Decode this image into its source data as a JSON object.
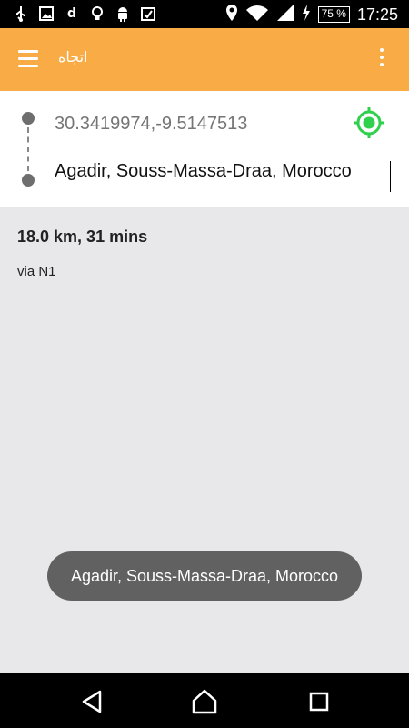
{
  "status_bar": {
    "left_icons": [
      "usb-icon",
      "image-icon",
      "d-icon",
      "lightbulb-icon",
      "android-icon",
      "clipboard-check-icon"
    ],
    "d_icon_text": "d",
    "right_icons": [
      "location-icon",
      "wifi-icon",
      "signal-icon",
      "charging-icon"
    ],
    "battery": "75 %",
    "time": "17:25"
  },
  "app_bar": {
    "title": "اتجاه",
    "color": "#f9ab46"
  },
  "route_inputs": {
    "from_placeholder": "30.3419974,-9.5147513",
    "to_value": "Agadir, Souss-Massa-Draa, Morocco"
  },
  "route": {
    "summary": "18.0 km, 31 mins",
    "via": "via N1"
  },
  "toast": {
    "text": "Agadir, Souss-Massa-Draa, Morocco"
  },
  "nav_bar": {
    "buttons": [
      "back",
      "home",
      "recent-apps"
    ]
  },
  "colors": {
    "accent": "#f9ab46",
    "locate_green": "#2fd14c"
  }
}
